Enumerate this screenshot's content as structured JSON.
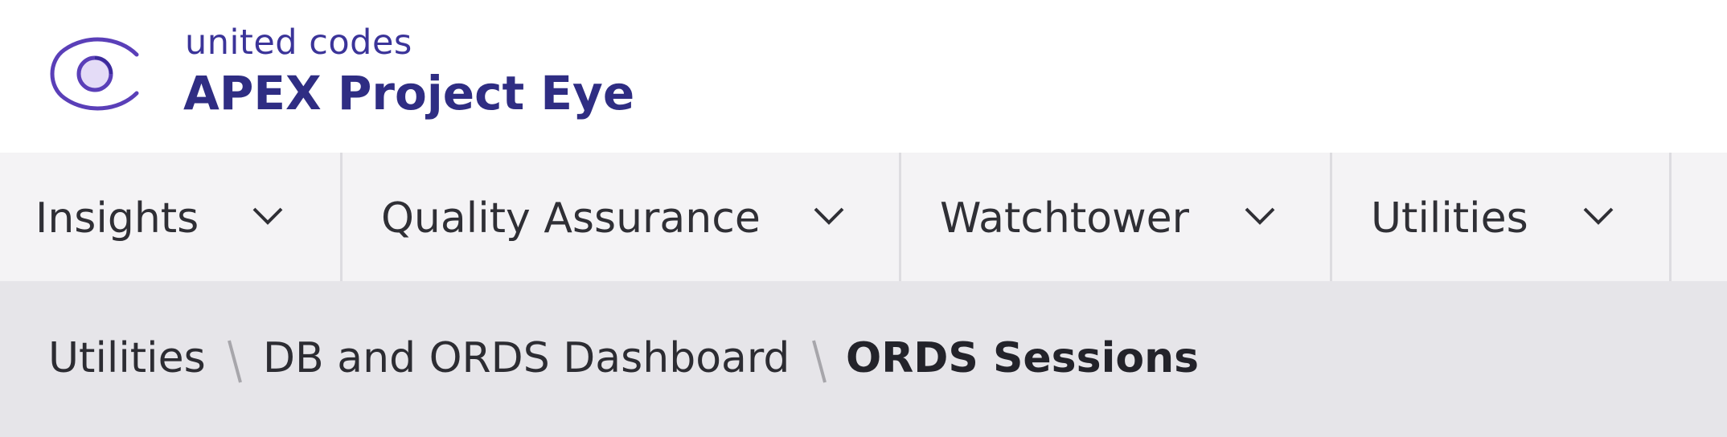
{
  "brand": {
    "company": "united codes",
    "app_title": "APEX Project Eye",
    "logo_icon": "eye-icon",
    "accent_color": "#5a3fb8"
  },
  "nav": {
    "items": [
      {
        "label": "Insights",
        "icon": "chevron-down-icon"
      },
      {
        "label": "Quality Assurance",
        "icon": "chevron-down-icon"
      },
      {
        "label": "Watchtower",
        "icon": "chevron-down-icon"
      },
      {
        "label": "Utilities",
        "icon": "chevron-down-icon"
      }
    ]
  },
  "breadcrumb": {
    "items": [
      "Utilities",
      "DB and ORDS Dashboard"
    ],
    "current": "ORDS Sessions",
    "separator": "\\"
  }
}
